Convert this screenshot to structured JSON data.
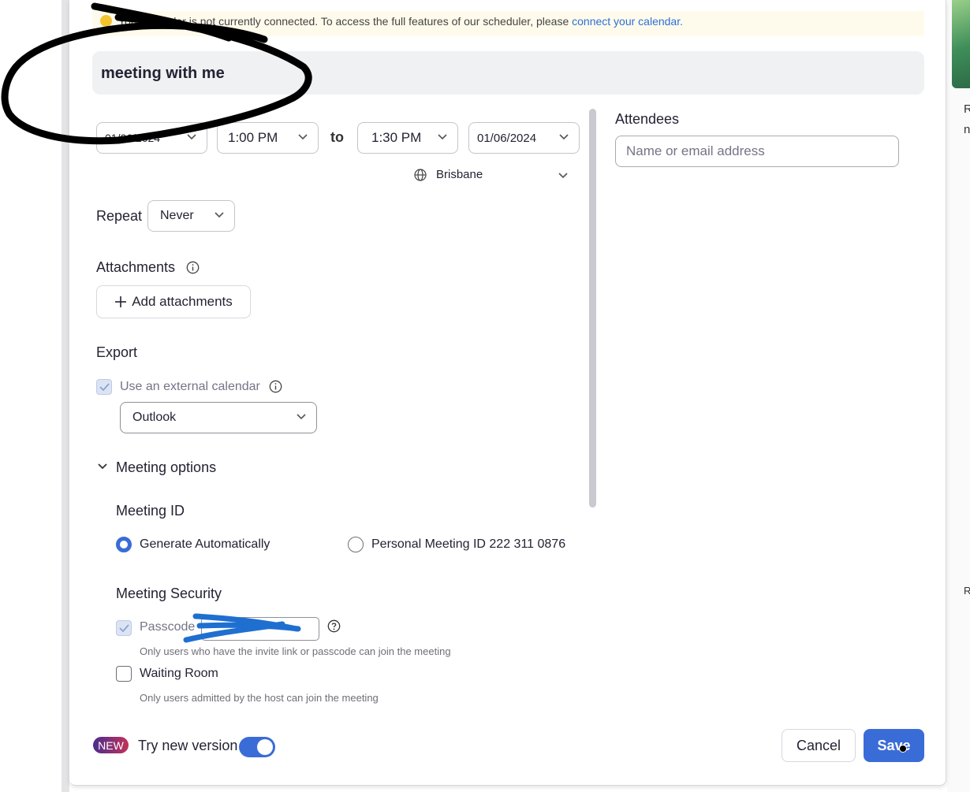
{
  "banner": {
    "text": "Your calendar is not currently connected. To access the full features of our scheduler, please ",
    "link": "connect your calendar."
  },
  "meeting": {
    "title": "meeting with me",
    "start_date": "01/06/2024",
    "start_time": "1:00 PM",
    "to_label": "to",
    "end_time": "1:30 PM",
    "end_date": "01/06/2024",
    "timezone": "Brisbane"
  },
  "repeat": {
    "label": "Repeat",
    "value": "Never"
  },
  "attachments": {
    "label": "Attachments",
    "add_button": "Add attachments"
  },
  "export": {
    "label": "Export",
    "external_calendar_label": "Use an external calendar",
    "calendar_value": "Outlook"
  },
  "meeting_options": {
    "label": "Meeting options",
    "meeting_id_label": "Meeting ID",
    "generate_auto": "Generate Automatically",
    "personal_id": "Personal Meeting ID 222 311 0876",
    "security_label": "Meeting Security",
    "passcode_label": "Passcode",
    "passcode_help": "Only users who have the invite link or passcode can join the meeting",
    "waiting_room_label": "Waiting Room",
    "waiting_room_help": "Only users admitted by the host can join the meeting"
  },
  "attendees": {
    "label": "Attendees",
    "placeholder": "Name or email address"
  },
  "footer": {
    "new_badge": "NEW",
    "try_new_label": "Try new version",
    "cancel": "Cancel",
    "save": "Save"
  },
  "right_panel": {
    "letter_1": "R",
    "letter_2": "n",
    "letter_3": "R"
  },
  "colors": {
    "accent": "#3a6cd8",
    "link": "#2d6fd9",
    "banner_bg": "#fffbec"
  }
}
